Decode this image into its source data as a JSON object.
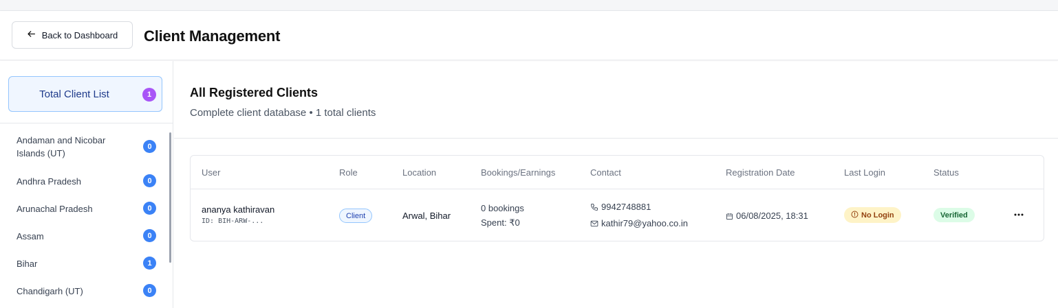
{
  "header": {
    "back_label": "Back to Dashboard",
    "title": "Client Management"
  },
  "sidebar": {
    "total_label": "Total Client List",
    "total_count": "1",
    "states": [
      {
        "name": "Andaman and Nicobar Islands (UT)",
        "count": "0"
      },
      {
        "name": "Andhra Pradesh",
        "count": "0"
      },
      {
        "name": "Arunachal Pradesh",
        "count": "0"
      },
      {
        "name": "Assam",
        "count": "0"
      },
      {
        "name": "Bihar",
        "count": "1"
      },
      {
        "name": "Chandigarh (UT)",
        "count": "0"
      }
    ]
  },
  "main": {
    "title": "All Registered Clients",
    "subtitle": "Complete client database • 1 total clients",
    "columns": [
      "User",
      "Role",
      "Location",
      "Bookings/Earnings",
      "Contact",
      "Registration Date",
      "Last Login",
      "Status"
    ],
    "rows": [
      {
        "name": "ananya kathiravan",
        "id": "ID: BIH-ARW-...",
        "role": "Client",
        "location": "Arwal, Bihar",
        "bookings": "0 bookings",
        "spent": "Spent: ₹0",
        "phone": "9942748881",
        "email": "kathir79@yahoo.co.in",
        "registered": "06/08/2025, 18:31",
        "last_login": "No Login",
        "status": "Verified"
      }
    ]
  },
  "colors": {
    "accent_purple": "#a855f7",
    "accent_blue": "#3b82f6",
    "pending_bg": "#fef3c7",
    "verified_bg": "#dcfce7"
  },
  "icons": [
    "arrow-left-icon",
    "phone-icon",
    "mail-icon",
    "calendar-icon",
    "clock-alert-icon",
    "more-horizontal-icon"
  ]
}
